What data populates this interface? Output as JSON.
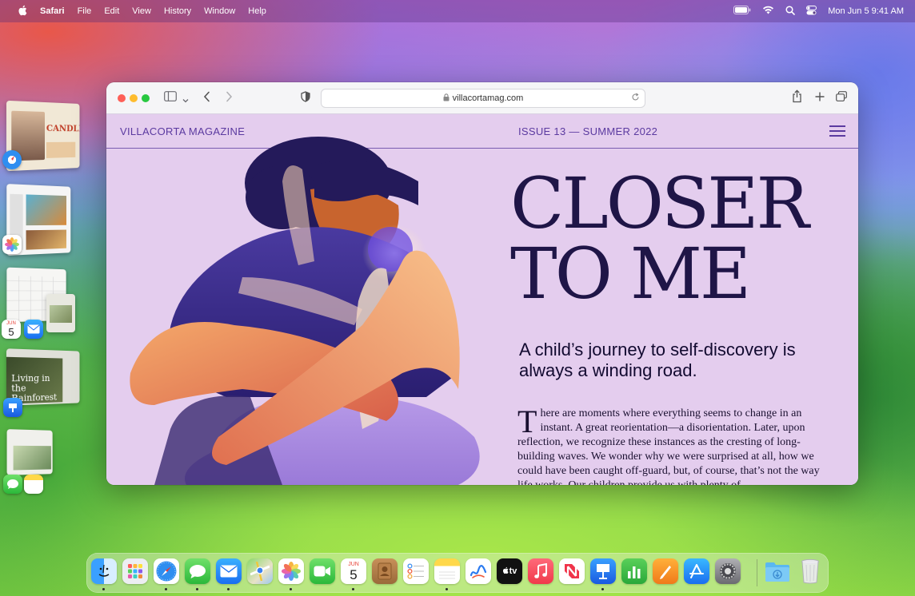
{
  "menubar": {
    "apple": "",
    "app_name": "Safari",
    "menus": [
      "File",
      "Edit",
      "View",
      "History",
      "Window",
      "Help"
    ],
    "clock": "Mon Jun 5  9:41 AM"
  },
  "stage_manager": {
    "groups": [
      {
        "app": "Safari",
        "thumb_text": "CANDLES"
      },
      {
        "app": "Photos",
        "thumb_text": ""
      },
      {
        "app": "Calendar + Mail",
        "thumb_text": ""
      },
      {
        "app": "Keynote",
        "thumb_text": "Living in the Rainforest"
      },
      {
        "app": "Messages + Notes",
        "thumb_text": ""
      }
    ],
    "calendar_month": "JUN",
    "calendar_day": "5"
  },
  "safari": {
    "url": "villacortamag.com"
  },
  "site": {
    "brand": "VILLACORTA MAGAZINE",
    "issue": "ISSUE 13 — SUMMER 2022",
    "headline_line1": "CLOSER",
    "headline_line2": "TO ME",
    "deck": "A child’s journey to self-discovery is always a winding road.",
    "dropcap": "T",
    "body": "here are moments where everything seems to change in an instant. A great reorientation—a disorientation. Later, upon reflection, we recognize these instances as the cresting of long-building waves. We wonder why we were surprised at all, how we could have been caught off-guard, but, of course, that’s not the way life works. Our children provide us with plenty of"
  },
  "dock": {
    "apps": [
      "Finder",
      "Launchpad",
      "Safari",
      "Messages",
      "Mail",
      "Maps",
      "Photos",
      "FaceTime",
      "Calendar",
      "Contacts",
      "Reminders",
      "Notes",
      "Freeform",
      "TV",
      "Music",
      "News",
      "Keynote",
      "Numbers",
      "Pages",
      "App Store",
      "System Settings",
      "Downloads",
      "Trash"
    ],
    "calendar_month": "JUN",
    "calendar_day": "5",
    "tv_label": "tv"
  },
  "colors": {
    "site_bg": "#e4cdee",
    "site_accent": "#5b3aa0",
    "headline": "#1f1547"
  }
}
